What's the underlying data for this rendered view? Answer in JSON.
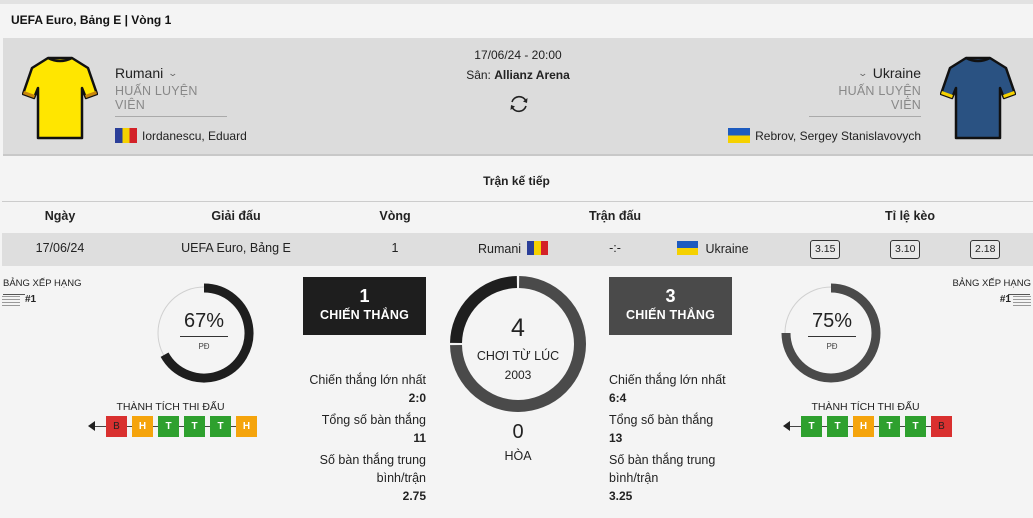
{
  "header": {
    "title": "UEFA Euro, Bảng E | Vòng 1"
  },
  "match": {
    "datetime": "17/06/24 - 20:00",
    "venue_label": "Sân:",
    "venue": "Allianz Arena",
    "home": {
      "name": "Rumani",
      "coach_label": "HUẤN LUYỆN VIÊN",
      "coach": "Iordanescu, Eduard",
      "jersey_color": "#ffe600",
      "jersey_trim": "#c8860b",
      "flag": "romania-flag"
    },
    "away": {
      "name": "Ukraine",
      "coach_label": "HUẤN LUYỆN VIÊN",
      "coach": "Rebrov, Sergey Stanislavovych",
      "jersey_color": "#2a5282",
      "jersey_trim": "#f5d100",
      "flag": "ukraine-flag"
    },
    "swap_icon": "refresh-icon"
  },
  "next_match": {
    "title": "Trận kế tiếp",
    "headers": [
      "Ngày",
      "Giải đấu",
      "Vòng",
      "Trận đấu",
      "Tỉ lệ kèo"
    ],
    "row": {
      "date": "17/06/24",
      "league": "UEFA Euro, Bảng E",
      "round": "1",
      "home": "Rumani",
      "score": "-:-",
      "away": "Ukraine",
      "odds": [
        "3.15",
        "3.10",
        "2.18"
      ]
    }
  },
  "home_panel": {
    "rank_label": "BẢNG XẾP HẠNG",
    "rank": "#1",
    "pd_percent": 67,
    "pd_text": "67%",
    "pd_label": "PĐ",
    "form_title": "THÀNH TÍCH THI ĐẤU",
    "form": [
      "B",
      "H",
      "T",
      "T",
      "T",
      "H"
    ]
  },
  "away_panel": {
    "rank_label": "BẢNG XẾP HẠNG",
    "rank": "#1",
    "pd_percent": 75,
    "pd_text": "75%",
    "pd_label": "PĐ",
    "form_title": "THÀNH TÍCH THI ĐẤU",
    "form": [
      "T",
      "T",
      "H",
      "T",
      "T",
      "B"
    ]
  },
  "h2h": {
    "home_wins": "1",
    "away_wins": "3",
    "wins_label": "CHIẾN THẮNG",
    "total": "4",
    "total_label": "CHƠI TỪ LÚC",
    "since": "2003",
    "draws": "0",
    "draws_label": "HÒA",
    "home_stats": {
      "biggest_win_label": "Chiến thắng lớn nhất",
      "biggest_win": "2:0",
      "total_goals_label": "Tổng số bàn thắng",
      "total_goals": "11",
      "avg_goals_label1": "Số bàn thắng trung",
      "avg_goals_label2": "bình/trận",
      "avg_goals": "2.75"
    },
    "away_stats": {
      "biggest_win_label": "Chiến thắng lớn nhất",
      "biggest_win": "6:4",
      "total_goals_label": "Tổng số bàn thắng",
      "total_goals": "13",
      "avg_goals_label1": "Số bàn thắng trung",
      "avg_goals_label2": "bình/trận",
      "avg_goals": "3.25"
    }
  },
  "colors": {
    "home_dark": "#1e1e1e",
    "away_dark": "#4a4a4a",
    "win": "#2ea02e",
    "draw": "#f5a40c",
    "loss": "#d9302f"
  }
}
